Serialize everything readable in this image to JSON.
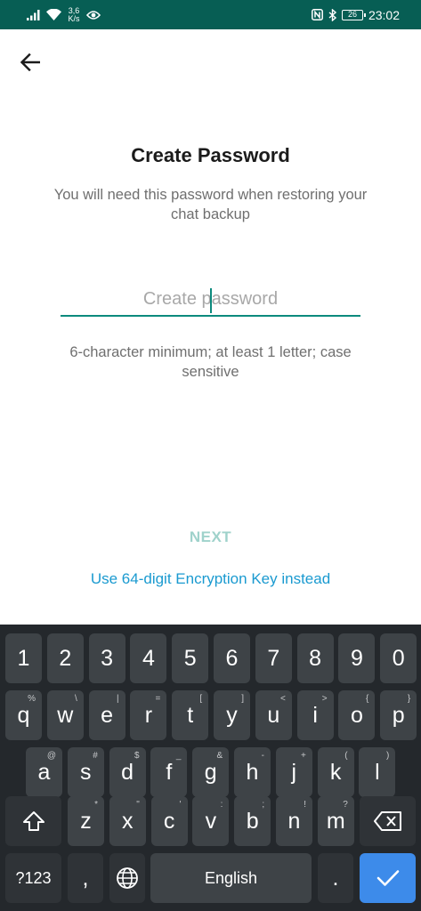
{
  "status_bar": {
    "net_speed_value": "3,6",
    "net_speed_unit": "K/s",
    "battery": "26",
    "time": "23:02"
  },
  "screen": {
    "title": "Create Password",
    "subtitle": "You will need this password when restoring your chat backup",
    "password_placeholder": "Create password",
    "password_value": "",
    "hint": "6-character minimum; at least 1 letter; case sensitive",
    "next_label": "NEXT",
    "alt_link": "Use 64-digit Encryption Key instead"
  },
  "colors": {
    "status_bar": "#075e54",
    "accent": "#0c8a7d",
    "next_disabled": "#9fd2cb",
    "link": "#1a9ad0",
    "keyboard_bg": "#24282c",
    "key_bg": "#3e4347",
    "enter_key": "#3d8bea"
  },
  "keyboard": {
    "numbers": [
      "1",
      "2",
      "3",
      "4",
      "5",
      "6",
      "7",
      "8",
      "9",
      "0"
    ],
    "row1": [
      {
        "k": "q",
        "s": "%"
      },
      {
        "k": "w",
        "s": "\\"
      },
      {
        "k": "e",
        "s": "|"
      },
      {
        "k": "r",
        "s": "="
      },
      {
        "k": "t",
        "s": "["
      },
      {
        "k": "y",
        "s": "]"
      },
      {
        "k": "u",
        "s": "<"
      },
      {
        "k": "i",
        "s": ">"
      },
      {
        "k": "o",
        "s": "{"
      },
      {
        "k": "p",
        "s": "}"
      }
    ],
    "row2": [
      {
        "k": "a",
        "s": "@"
      },
      {
        "k": "s",
        "s": "#"
      },
      {
        "k": "d",
        "s": "$"
      },
      {
        "k": "f",
        "s": "_"
      },
      {
        "k": "g",
        "s": "&"
      },
      {
        "k": "h",
        "s": "-"
      },
      {
        "k": "j",
        "s": "+"
      },
      {
        "k": "k",
        "s": "("
      },
      {
        "k": "l",
        "s": ")"
      }
    ],
    "row3": [
      {
        "k": "z",
        "s": "*"
      },
      {
        "k": "x",
        "s": "\""
      },
      {
        "k": "c",
        "s": "'"
      },
      {
        "k": "v",
        "s": ":"
      },
      {
        "k": "b",
        "s": ";"
      },
      {
        "k": "n",
        "s": "!"
      },
      {
        "k": "m",
        "s": "?"
      }
    ],
    "symbols_label": "?123",
    "comma": ",",
    "space_label": "English",
    "period": ".",
    "icons": {
      "shift": "shift-icon",
      "backspace": "backspace-icon",
      "language": "globe-icon",
      "enter": "check-icon"
    }
  }
}
